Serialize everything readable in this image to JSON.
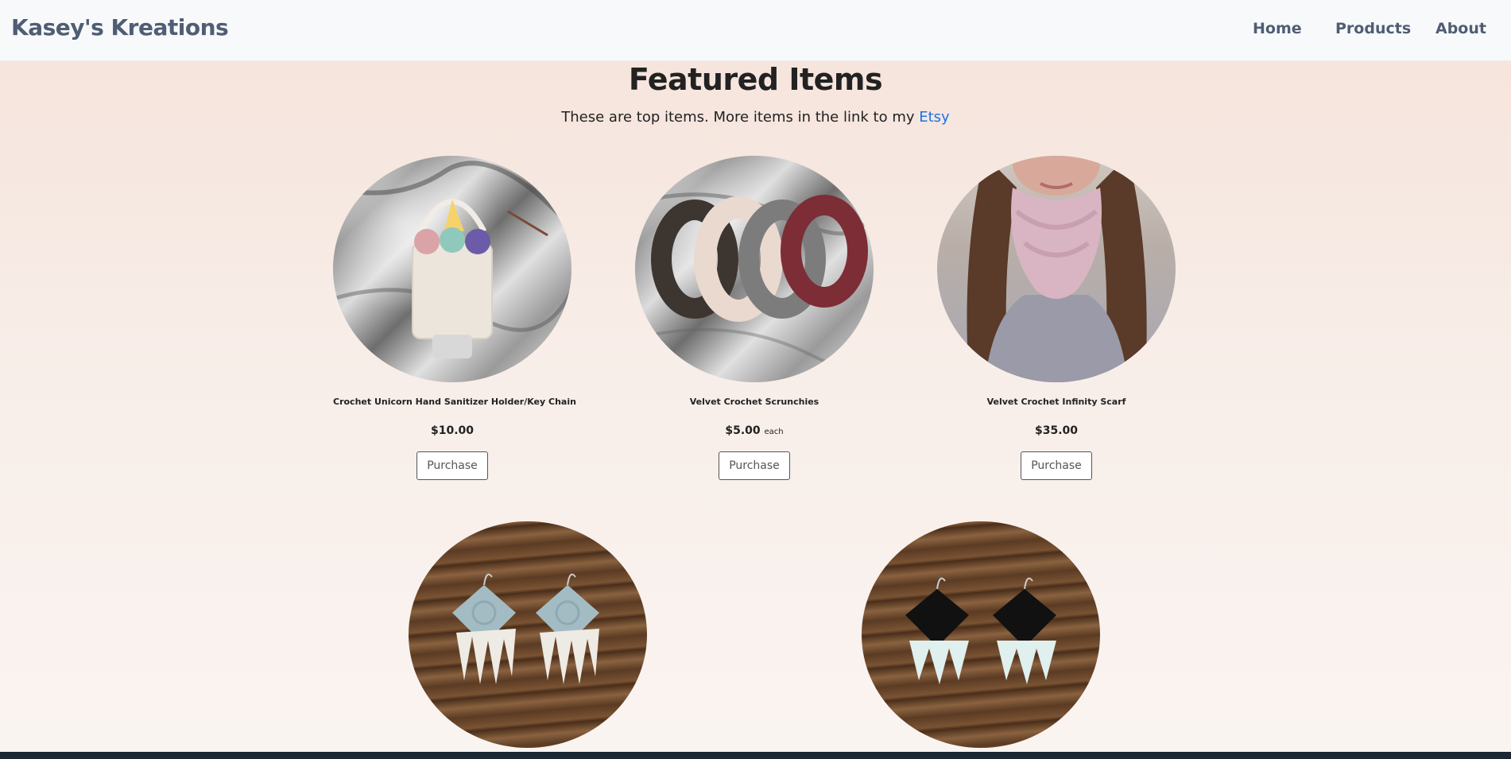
{
  "navbar": {
    "brand": "Kasey's Kreations",
    "links": [
      "Home",
      "Products",
      "About"
    ]
  },
  "header": {
    "title": "Featured Items",
    "subtitle_text": "These are top items. More items in the link to my ",
    "subtitle_link": "Etsy"
  },
  "items": [
    {
      "name": "Crochet Unicorn Hand Sanitizer Holder/Key Chain",
      "price": "$10.00",
      "unit": "",
      "button": "Purchase"
    },
    {
      "name": "Velvet Crochet Scrunchies",
      "price": "$5.00",
      "unit": "each",
      "button": "Purchase"
    },
    {
      "name": "Velvet Crochet Infinity Scarf",
      "price": "$35.00",
      "unit": "",
      "button": "Purchase"
    },
    {
      "name": "",
      "price": "",
      "unit": "",
      "button": ""
    },
    {
      "name": "",
      "price": "",
      "unit": "",
      "button": ""
    }
  ],
  "colors": {
    "nav_text": "#4f5d75",
    "link": "#1a73e8",
    "bg_top": "#f5e3da",
    "bg_bottom": "#faf4f1"
  }
}
